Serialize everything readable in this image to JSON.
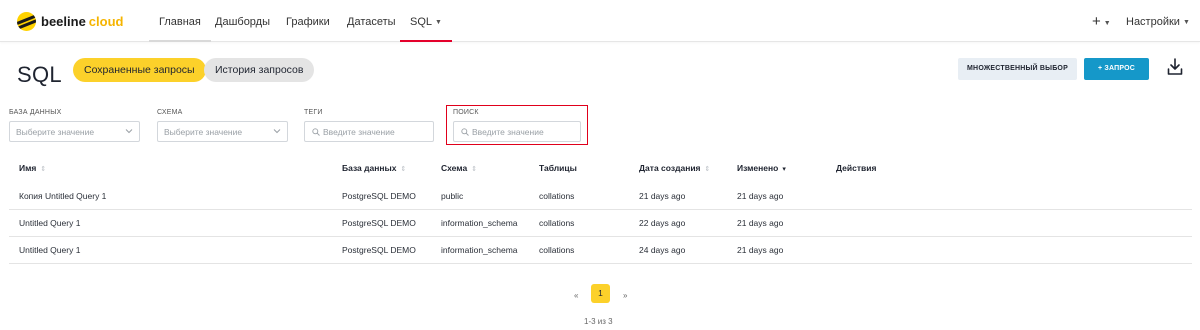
{
  "navbar": {
    "brand": "beeline",
    "brand_accent": "cloud",
    "items": [
      {
        "label": "Главная"
      },
      {
        "label": "Дашборды"
      },
      {
        "label": "Графики"
      },
      {
        "label": "Датасеты"
      },
      {
        "label": "SQL"
      }
    ],
    "plus_label": "+",
    "settings_label": "Настройки"
  },
  "header": {
    "title": "SQL",
    "tabs": [
      {
        "label": "Сохраненные запросы",
        "active": true
      },
      {
        "label": "История запросов",
        "active": false
      }
    ],
    "multi_select_label": "МНОЖЕСТВЕННЫЙ ВЫБОР",
    "add_query_label": "+ ЗАПРОС"
  },
  "filters": [
    {
      "label": "БАЗА ДАННЫХ",
      "placeholder": "Выберите значение"
    },
    {
      "label": "СХЕМА",
      "placeholder": "Выберите значение"
    },
    {
      "label": "ТЕГИ",
      "placeholder": "Введите значение"
    },
    {
      "label": "ПОИСК",
      "placeholder": "Введите значение"
    }
  ],
  "table": {
    "columns": [
      "Имя",
      "База данных",
      "Схема",
      "Таблицы",
      "Дата создания",
      "Изменено",
      "Действия"
    ],
    "rows": [
      [
        "Копия Untitled Query 1",
        "PostgreSQL DEMO",
        "public",
        "collations",
        "21 days ago",
        "21 days ago"
      ],
      [
        "Untitled Query 1",
        "PostgreSQL DEMO",
        "information_schema",
        "collations",
        "22 days ago",
        "21 days ago"
      ],
      [
        "Untitled Query 1",
        "PostgreSQL DEMO",
        "information_schema",
        "collations",
        "24 days ago",
        "21 days ago"
      ]
    ]
  },
  "pagination": {
    "prev": "«",
    "current_page": "1",
    "next": "»",
    "info": "1-3 из 3"
  },
  "colors": {
    "brand_yellow": "#fcd12a",
    "primary_blue": "#1598c9",
    "highlight_red": "#e0001b"
  }
}
